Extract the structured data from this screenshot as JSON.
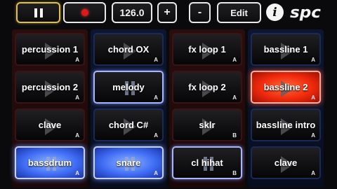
{
  "toolbar": {
    "pause_label": "pause",
    "record_label": "record",
    "tempo": "126.0",
    "plus": "+",
    "minus": "-",
    "edit": "Edit",
    "info": "i",
    "logo": "spc"
  },
  "colors": {
    "column_red_tint": "#2a0d0d",
    "column_blue_tint": "#0d1630",
    "active_red": "#f02a0c",
    "active_blue": "#3f6df5",
    "selected_outline_blue": "#a8b6ff"
  },
  "columns": [
    {
      "tint": "red",
      "pads": [
        {
          "label": "percussion 1",
          "slot": "A",
          "state": "idle",
          "icon": "play-icon"
        },
        {
          "label": "percussion 2",
          "slot": "A",
          "state": "idle",
          "icon": "play-icon"
        },
        {
          "label": "clave",
          "slot": "A",
          "state": "idle",
          "icon": "play-icon"
        },
        {
          "label": "bassdrum",
          "slot": "A",
          "state": "active-blue",
          "icon": "pause-icon"
        }
      ]
    },
    {
      "tint": "blue",
      "pads": [
        {
          "label": "chord OX",
          "slot": "A",
          "state": "idle",
          "icon": "play-icon"
        },
        {
          "label": "melody",
          "slot": "A",
          "state": "selected-blue",
          "icon": "pause-icon"
        },
        {
          "label": "chord C#",
          "slot": "A",
          "state": "idle",
          "icon": "play-icon"
        },
        {
          "label": "snare",
          "slot": "A",
          "state": "active-blue",
          "icon": "pause-icon"
        }
      ]
    },
    {
      "tint": "red",
      "pads": [
        {
          "label": "fx loop 1",
          "slot": "A",
          "state": "idle",
          "icon": "play-icon"
        },
        {
          "label": "fx loop 2",
          "slot": "A",
          "state": "idle",
          "icon": "play-icon"
        },
        {
          "label": "sklr",
          "slot": "B",
          "state": "idle",
          "icon": "play-icon"
        },
        {
          "label": "cl hihat",
          "slot": "B",
          "state": "selected-blue",
          "icon": "pause-icon"
        }
      ]
    },
    {
      "tint": "blue",
      "pads": [
        {
          "label": "bassline 1",
          "slot": "A",
          "state": "idle",
          "icon": "play-icon"
        },
        {
          "label": "bassline 2",
          "slot": "A",
          "state": "active-red",
          "icon": "play-icon"
        },
        {
          "label": "bassline intro",
          "slot": "A",
          "state": "idle",
          "icon": "play-icon"
        },
        {
          "label": "clave",
          "slot": "A",
          "state": "idle",
          "icon": "play-icon"
        }
      ]
    }
  ]
}
